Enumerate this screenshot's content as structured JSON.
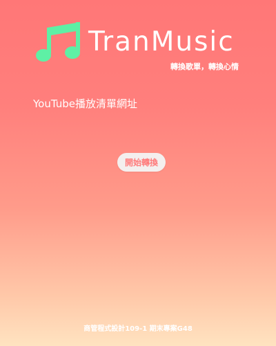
{
  "header": {
    "logo_icon": "music-note-icon",
    "brand_name": "TranMusic",
    "slogan": "轉換歌單，轉換心情",
    "accent_color": "#5ef0a5"
  },
  "main": {
    "playlist_label": "YouTube播放清單網址",
    "start_button_label": "開始轉換"
  },
  "footer": {
    "text": "商管程式設計109-1 期末專案G48"
  }
}
